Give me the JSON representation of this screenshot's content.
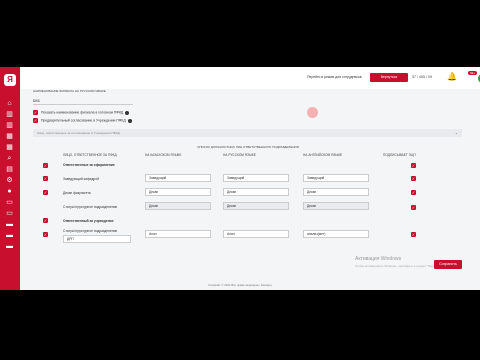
{
  "sidebar": {
    "logo": "Я",
    "logo_caption": "",
    "icons": [
      "home-icon",
      "bank-icon",
      "bank-icon",
      "grid-icon",
      "grid-icon",
      "search-icon",
      "chat-icon",
      "settings-icon",
      "user-icon",
      "document-icon",
      "document-icon",
      "folder-icon",
      "folder-icon",
      "folder-icon"
    ]
  },
  "topbar": {
    "help_link": "Перейти в режим для сотрудников",
    "home_button": "Вернуться",
    "time": "57 / 405 / 09",
    "badge": "99+",
    "avatar": "Л"
  },
  "form": {
    "top_label": "НАИМЕНОВАНИЕ ФИЛИАЛА НА РУССКОМ ЯЗЫКЕ",
    "main_input": "БКБ",
    "check_1": "Показать наименование филиала в головном ПФКД",
    "check_2": "Предварительный согласование в Учреждении ПФКД",
    "collapse_label": "Лица, ответственные за согласование в Учреждении ПФКД",
    "table_caption": "СПИСОК ДОЛЖНОСТНЫХ ЛИЦ ОТВЕТСТВЕННОГО ПОДРАЗДЕЛЕНИЯ",
    "headers": [
      "ЛИЦО, ОТВЕТСТВЕННОЕ ЗА ПФКД",
      "НА КАЗАХСКОМ ЯЗЫКЕ",
      "НА РУССКОМ ЯЗЫКЕ",
      "НА АНГЛИЙСКОМ ЯЗЫКЕ",
      "ПОДПИСЫВАЕТ ЭЦП"
    ],
    "sections": [
      {
        "title": "Ответственные за оформление",
        "rows": [
          {
            "label": "Заведующий кафедрой",
            "kz": "Заведущий",
            "ru": "Заведущий",
            "en": "Заведущий",
            "grey": false
          },
          {
            "label": "Декан факультета",
            "kz": "Декан",
            "ru": "Декан",
            "en": "Декан",
            "grey": false
          },
          {
            "label": "Статус/структурное подразделение",
            "kz": "Декан",
            "ru": "Декан",
            "en": "Декан",
            "grey": true
          }
        ]
      },
      {
        "title": "Ответственный за учреждение",
        "rows": [
          {
            "label": "Статус/структурное подразделение",
            "sub": "ДРП",
            "kz": "Анал",
            "ru": "Анал",
            "en": "анализ(мет)",
            "grey": false
          }
        ]
      }
    ]
  },
  "watermark": {
    "title": "Активация Windows",
    "subtitle": "Чтобы активировать Windows, перейдите в раздел \"Параметры\"."
  },
  "save_button": "Сохранить",
  "footer": "Копирайт © 2024 Все права защищены. Казанец"
}
